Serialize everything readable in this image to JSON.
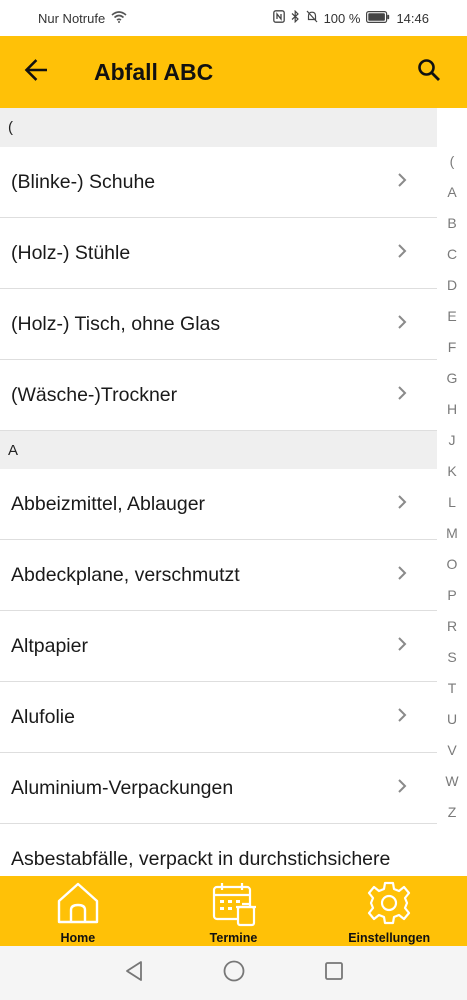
{
  "status_bar": {
    "carrier": "Nur Notrufe",
    "battery": "100 %",
    "time": "14:46"
  },
  "app_bar": {
    "title": "Abfall ABC"
  },
  "sections": [
    {
      "header": "(",
      "items": [
        "(Blinke-) Schuhe",
        "(Holz-) Stühle",
        "(Holz-) Tisch, ohne Glas",
        "(Wäsche-)Trockner"
      ]
    },
    {
      "header": "A",
      "items": [
        "Abbeizmittel, Ablauger",
        "Abdeckplane, verschmutzt",
        "Altpapier",
        "Alufolie",
        "Aluminium-Verpackungen",
        "Asbestabfälle, verpackt in durchstichsichere"
      ]
    }
  ],
  "alpha_index": [
    "(",
    "A",
    "B",
    "C",
    "D",
    "E",
    "F",
    "G",
    "H",
    "J",
    "K",
    "L",
    "M",
    "O",
    "P",
    "R",
    "S",
    "T",
    "U",
    "V",
    "W",
    "Z"
  ],
  "bottom_nav": {
    "home": "Home",
    "termine": "Termine",
    "einstellungen": "Einstellungen"
  },
  "colors": {
    "accent": "#ffc107",
    "section_bg": "#efefef"
  }
}
